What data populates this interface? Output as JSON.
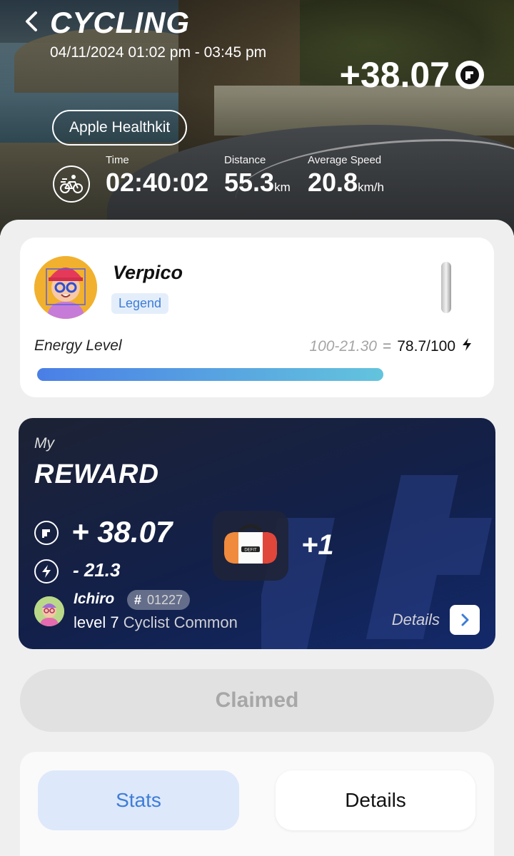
{
  "header": {
    "title": "CYCLING",
    "datetime": "04/11/2024 01:02 pm - 03:45 pm",
    "earned": "+38.07",
    "source_button": "Apple Healthkit"
  },
  "metrics": [
    {
      "label": "Time",
      "value": "02:40:02",
      "unit": ""
    },
    {
      "label": "Distance",
      "value": "55.3",
      "unit": "km"
    },
    {
      "label": "Average Speed",
      "value": "20.8",
      "unit": "km/h"
    }
  ],
  "profile": {
    "username": "Verpico",
    "rank": "Legend",
    "energy_label": "Energy Level",
    "energy_calc": "100-21.30",
    "energy_equals": "=",
    "energy_value": "78.7/100",
    "energy_fraction": 0.787
  },
  "reward": {
    "my_label": "My",
    "title": "REWARD",
    "coin_amount": "+ 38.07",
    "energy_amount": "- 21.3",
    "item_count": "+1",
    "item_brand": "DEFIT",
    "pet_name": "Ichiro",
    "pet_hash": "#",
    "pet_id": "01227",
    "pet_level": "level 7",
    "pet_class": "Cyclist Common",
    "details_label": "Details"
  },
  "claim_button": "Claimed",
  "tabs": [
    {
      "label": "Stats",
      "active": true
    },
    {
      "label": "Details",
      "active": false
    }
  ],
  "colors": {
    "accent": "#3e7dd6",
    "reward_bg": "#13296a",
    "energy_start": "#4a7fe6",
    "energy_end": "#63c4dd"
  },
  "icons": [
    "back-arrow-icon",
    "coin-icon",
    "bicycle-icon",
    "lightning-icon",
    "chevron-right-icon",
    "bag-icon"
  ]
}
